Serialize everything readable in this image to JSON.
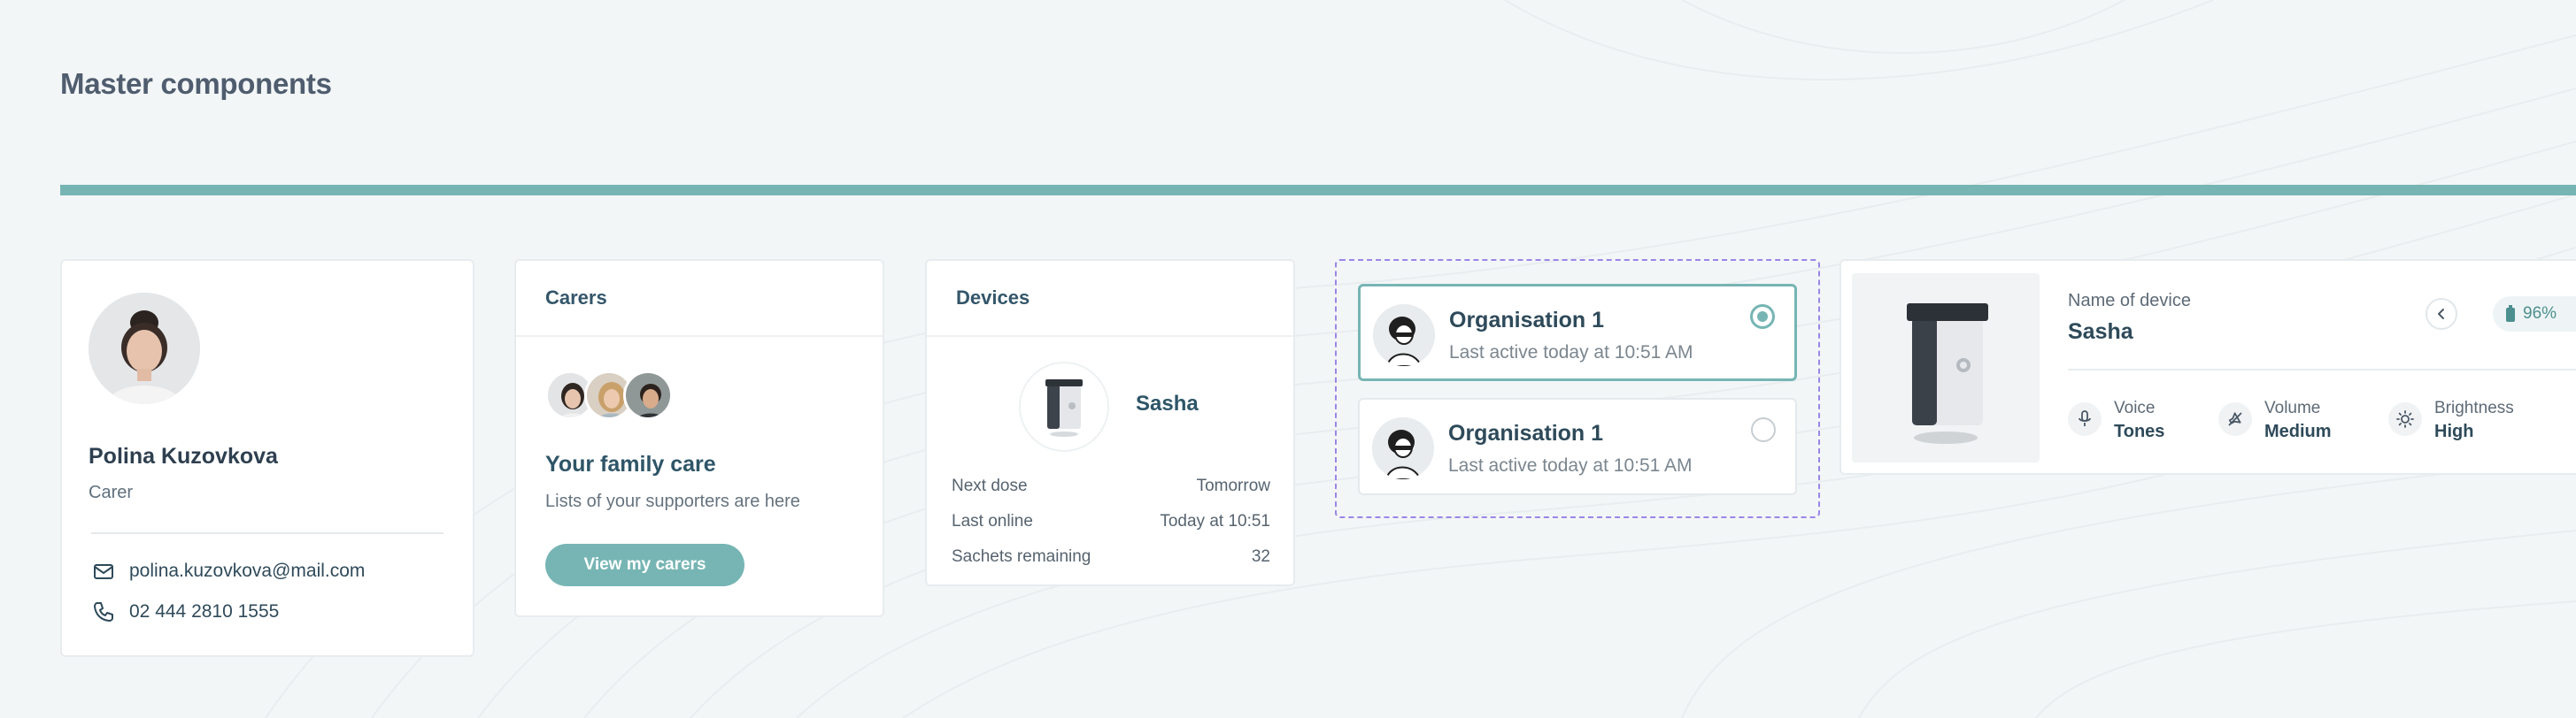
{
  "page": {
    "title": "Master components"
  },
  "colors": {
    "accent": "#76b5b4",
    "selection_outline": "#9b86e6",
    "background": "#f3f6f7"
  },
  "profile_card": {
    "name": "Polina Kuzovkova",
    "role": "Carer",
    "email": "polina.kuzovkova@mail.com",
    "phone": "02 444 2810 1555",
    "icons": {
      "email": "mail-icon",
      "phone": "phone-icon"
    }
  },
  "carers_card": {
    "header": "Carers",
    "heading": "Your family care",
    "subtext": "Lists of your supporters are here",
    "button_label": "View my carers",
    "avatar_count": 3
  },
  "devices_card": {
    "header": "Devices",
    "device_name": "Sasha",
    "rows": [
      {
        "label": "Next dose",
        "value": "Tomorrow"
      },
      {
        "label": "Last online",
        "value": "Today at 10:51"
      },
      {
        "label": "Sachets remaining",
        "value": "32"
      }
    ]
  },
  "organisations": [
    {
      "name": "Organisation 1",
      "last_active": "Last active today at 10:51 AM",
      "selected": true
    },
    {
      "name": "Organisation 1",
      "last_active": "Last active today at 10:51 AM",
      "selected": false
    }
  ],
  "device_detail": {
    "name_label": "Name of device",
    "name_value": "Sasha",
    "battery": "96%",
    "settings": [
      {
        "label": "Voice",
        "value": "Tones",
        "icon": "microphone-icon"
      },
      {
        "label": "Volume",
        "value": "Medium",
        "icon": "volume-icon"
      },
      {
        "label": "Brightness",
        "value": "High",
        "icon": "sun-icon"
      }
    ]
  }
}
